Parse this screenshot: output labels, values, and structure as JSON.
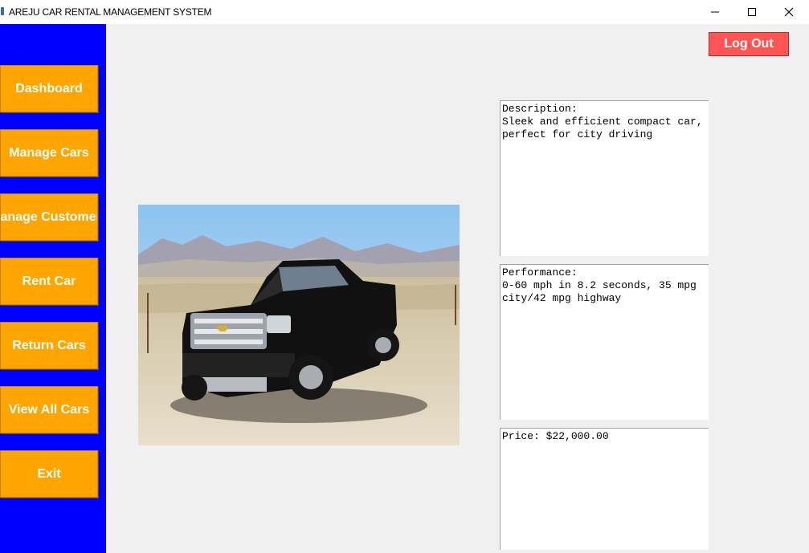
{
  "window": {
    "title": "AREJU CAR RENTAL MANAGEMENT SYSTEM",
    "controls": [
      "minimize-icon",
      "maximize-icon",
      "close-icon"
    ]
  },
  "sidebar": {
    "background": "#0000ff",
    "button_color": "#ffa500",
    "items": [
      {
        "label": "Dashboard"
      },
      {
        "label": "Manage Cars"
      },
      {
        "label": "Manage Customers"
      },
      {
        "label": "Rent Car"
      },
      {
        "label": "Return Cars"
      },
      {
        "label": "View All Cars"
      },
      {
        "label": "Exit"
      }
    ]
  },
  "header": {
    "logout_label": "Log Out",
    "logout_color": "#ff5555"
  },
  "car": {
    "image": "black pickup truck photo",
    "description": "Description:\nSleek and efficient compact car,\nperfect for city driving",
    "performance": "Performance:\n0-60 mph in 8.2 seconds, 35 mpg\ncity/42 mpg highway",
    "price": "Price: $22,000.00"
  }
}
